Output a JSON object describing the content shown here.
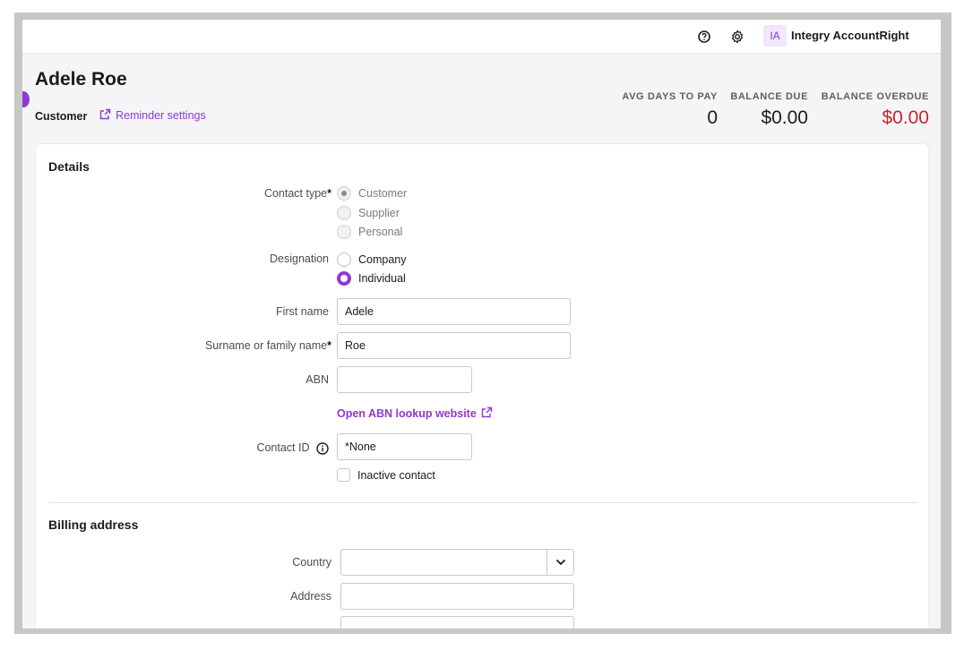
{
  "header": {
    "avatar_initials": "IA",
    "business_name": "Integry AccountRight"
  },
  "contact": {
    "name": "Adele Roe",
    "type": "Customer",
    "reminder_link": "Reminder settings"
  },
  "stats": [
    {
      "label": "AVG DAYS TO PAY",
      "value": "0"
    },
    {
      "label": "BALANCE DUE",
      "value": "$0.00"
    },
    {
      "label": "BALANCE OVERDUE",
      "value": "$0.00"
    }
  ],
  "details": {
    "title": "Details",
    "contact_type_label": "Contact type",
    "required_mark": "*",
    "contact_type_options": [
      "Customer",
      "Supplier",
      "Personal"
    ],
    "contact_type_selected": "Customer",
    "designation_label": "Designation",
    "designation_options": [
      "Company",
      "Individual"
    ],
    "designation_selected": "Individual",
    "first_name_label": "First name",
    "first_name_value": "Adele",
    "surname_label": "Surname or family name",
    "surname_value": "Roe",
    "abn_label": "ABN",
    "abn_value": "",
    "abn_lookup_link": "Open ABN lookup website",
    "contact_id_label": "Contact ID",
    "contact_id_value": "*None",
    "inactive_label": "Inactive contact",
    "inactive_checked": false
  },
  "billing": {
    "title": "Billing address",
    "country_label": "Country",
    "country_value": "",
    "address_label": "Address",
    "address_value": ""
  },
  "colors": {
    "accent": "#8e39d6",
    "overdue": "#c3282b"
  }
}
